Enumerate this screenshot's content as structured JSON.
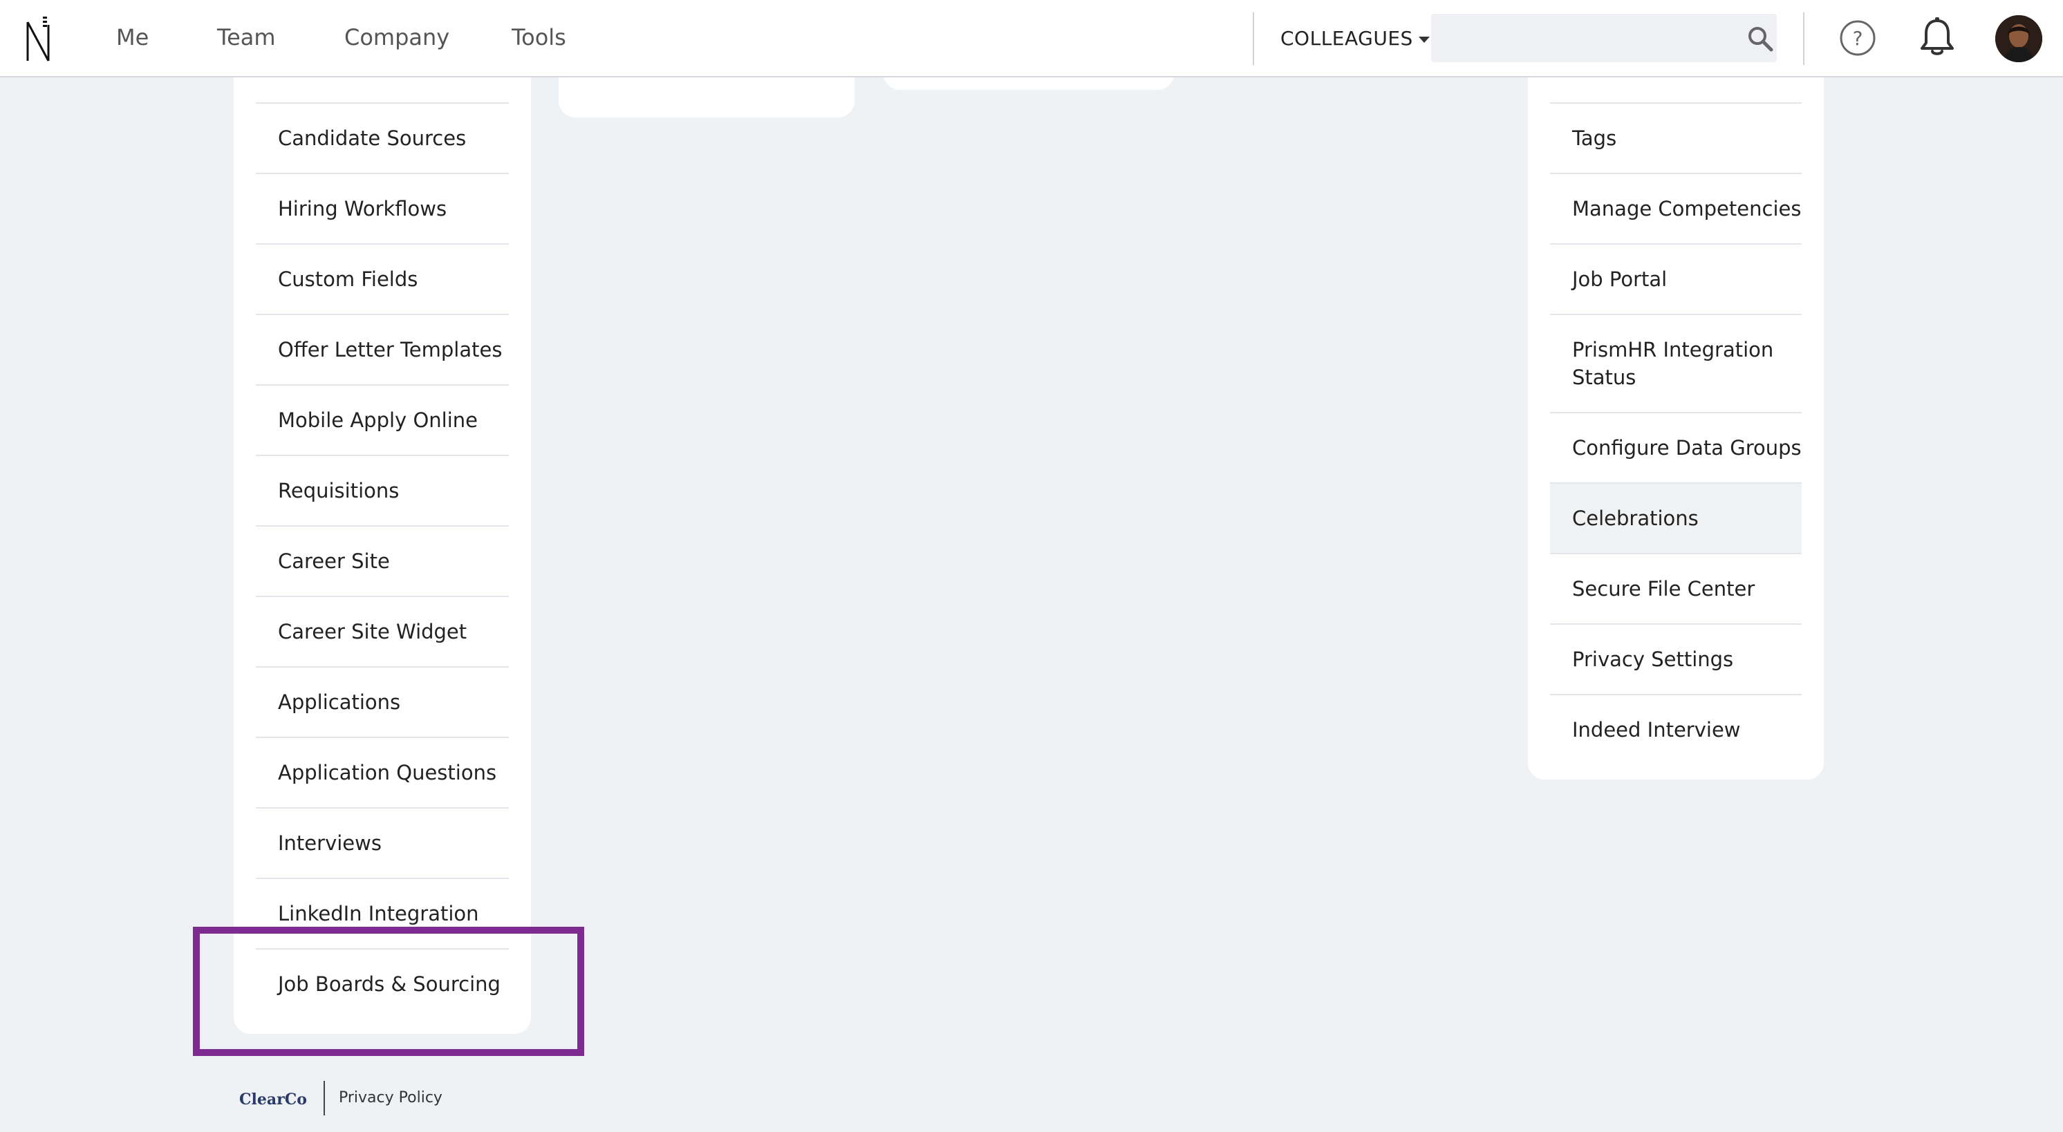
{
  "nav": {
    "items": [
      {
        "label": "Me"
      },
      {
        "label": "Team"
      },
      {
        "label": "Company"
      },
      {
        "label": "Tools"
      }
    ],
    "colleagues_label": "COLLEAGUES",
    "search": {
      "value": "",
      "placeholder": ""
    }
  },
  "left_menu": {
    "items": [
      {
        "label": "Candidate Sources"
      },
      {
        "label": "Hiring Workflows"
      },
      {
        "label": "Custom Fields"
      },
      {
        "label": "Offer Letter Templates"
      },
      {
        "label": "Mobile Apply Online"
      },
      {
        "label": "Requisitions"
      },
      {
        "label": "Career Site"
      },
      {
        "label": "Career Site Widget"
      },
      {
        "label": "Applications"
      },
      {
        "label": "Application Questions"
      },
      {
        "label": "Interviews"
      },
      {
        "label": "LinkedIn Integration"
      },
      {
        "label": "Job Boards & Sourcing"
      }
    ]
  },
  "right_menu": {
    "items": [
      {
        "label": "Tags"
      },
      {
        "label": "Manage Competencies"
      },
      {
        "label": "Job Portal"
      },
      {
        "label": "PrismHR Integration Status"
      },
      {
        "label": "Configure Data Groups"
      },
      {
        "label": "Celebrations"
      },
      {
        "label": "Secure File Center"
      },
      {
        "label": "Privacy Settings"
      },
      {
        "label": "Indeed Interview"
      }
    ]
  },
  "footer": {
    "brand": "ClearCo",
    "privacy_label": "Privacy Policy"
  },
  "colors": {
    "highlight_border": "#7e2b91",
    "page_background": "#eff2f5"
  }
}
